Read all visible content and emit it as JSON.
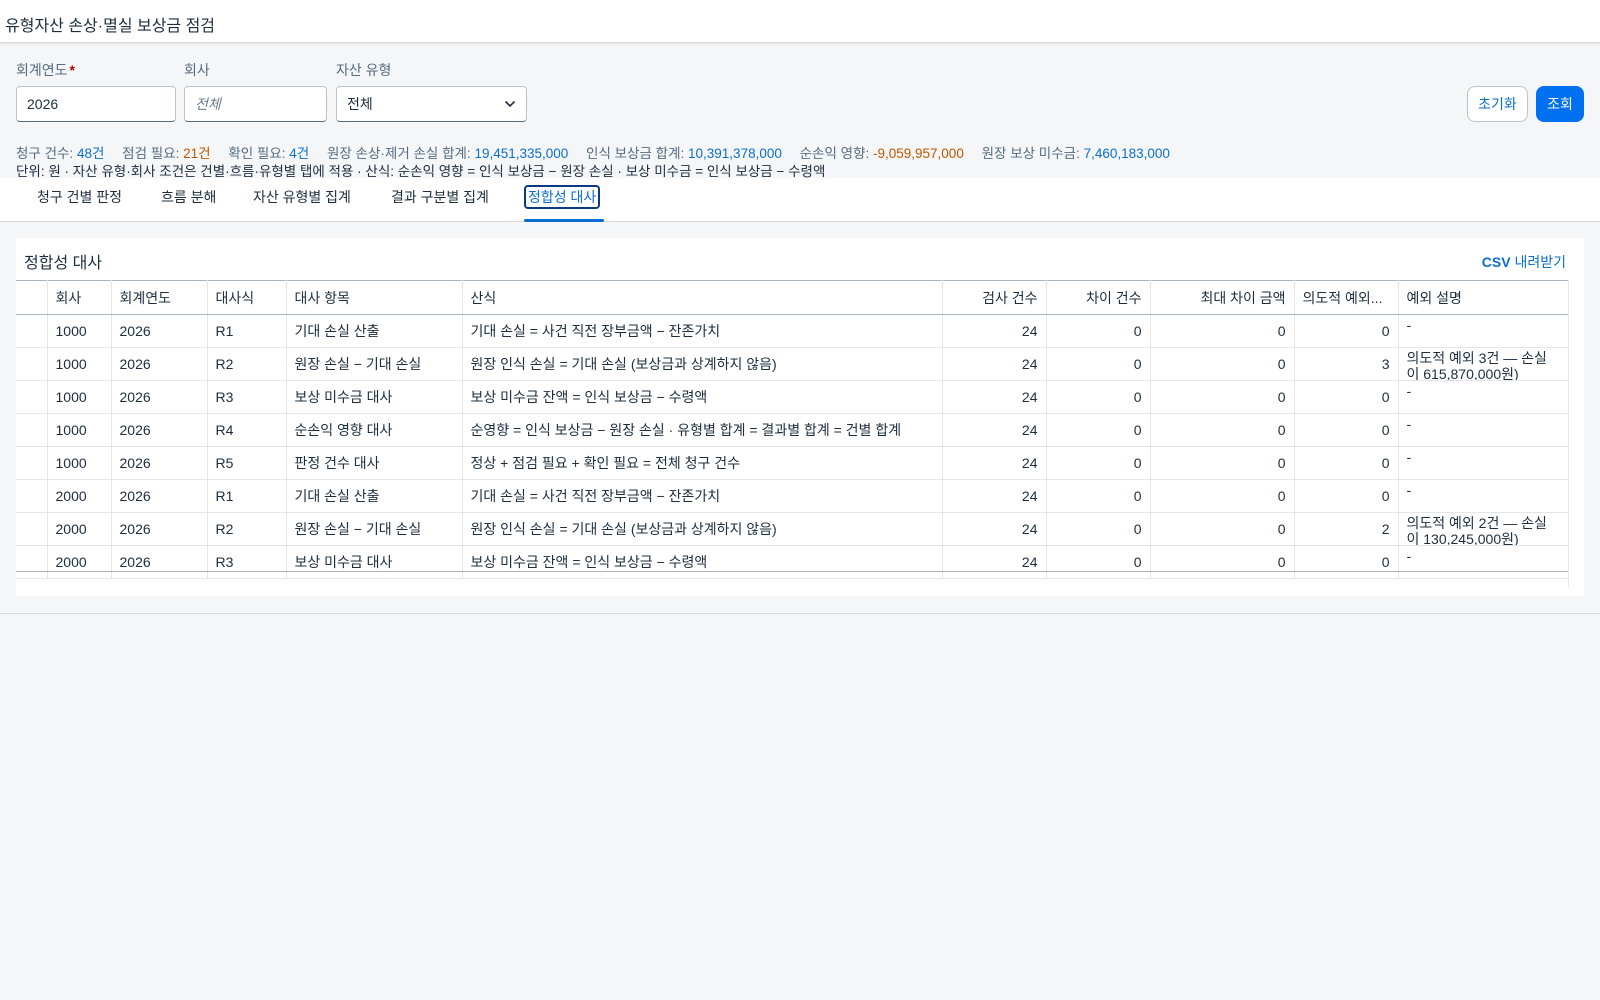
{
  "app": {
    "title": "유형자산 손상·멸실 보상금 점검"
  },
  "filters": {
    "fiscal_year_label": "회계연도",
    "fiscal_year_required": "*",
    "fiscal_year_value": "2026",
    "company_label": "회사",
    "company_placeholder": "전체",
    "asset_type_label": "자산 유형",
    "asset_type_value": "전체"
  },
  "actions": {
    "reset_label": "초기화",
    "search_label": "조회"
  },
  "summary": {
    "claims_label": "청구 건수:",
    "claims_value": "48건",
    "review_label": "점검 필요:",
    "review_value": "21건",
    "confirm_label": "확인 필요:",
    "confirm_value": "4건",
    "ledger_loss_label": "원장 손상·제거 손실 합계:",
    "ledger_loss_value": "19,451,335,000",
    "recognized_label": "인식 보상금 합계:",
    "recognized_value": "10,391,378,000",
    "net_impact_label": "순손익 영향:",
    "net_impact_value": "-9,059,957,000",
    "receivable_label": "원장 보상 미수금:",
    "receivable_value": "7,460,183,000",
    "note": "단위: 원 · 자산 유형·회사 조건은 건별·흐름·유형별 탭에 적용 · 산식: 순손익 영향 = 인식 보상금 − 원장 손실 · 보상 미수금 = 인식 보상금 − 수령액",
    "colors": {
      "value_blue": "#0a6ed1",
      "value_orange": "#c35500"
    }
  },
  "tabs": [
    {
      "label": "청구 건별 판정"
    },
    {
      "label": "흐름 분해"
    },
    {
      "label": "자산 유형별 집계"
    },
    {
      "label": "결과 구분별 집계"
    },
    {
      "label": "정합성 대사",
      "active": true
    }
  ],
  "panel": {
    "title": "정합성 대사",
    "csv_prefix": "CSV",
    "csv_label": "내려받기"
  },
  "table": {
    "columns": [
      "",
      "회사",
      "회계연도",
      "대사식",
      "대사 항목",
      "산식",
      "검사 건수",
      "차이 건수",
      "최대 차이 금액",
      "의도적 예외...",
      "예외 설명"
    ],
    "rows": [
      [
        "",
        "1000",
        "2026",
        "R1",
        "기대 손실 산출",
        "기대 손실 = 사건 직전 장부금액 − 잔존가치",
        "24",
        "0",
        "0",
        "0",
        "-"
      ],
      [
        "",
        "1000",
        "2026",
        "R2",
        "원장 손실 − 기대 손실",
        "원장 인식 손실 = 기대 손실 (보상금과 상계하지 않음)",
        "24",
        "0",
        "0",
        "3",
        "의도적 예외 3건 — 손실이 615,870,000원)"
      ],
      [
        "",
        "1000",
        "2026",
        "R3",
        "보상 미수금 대사",
        "보상 미수금 잔액 = 인식 보상금 − 수령액",
        "24",
        "0",
        "0",
        "0",
        "-"
      ],
      [
        "",
        "1000",
        "2026",
        "R4",
        "순손익 영향 대사",
        "순영향 = 인식 보상금 − 원장 손실 · 유형별 합계 = 결과별 합계 = 건별 합계",
        "24",
        "0",
        "0",
        "0",
        "-"
      ],
      [
        "",
        "1000",
        "2026",
        "R5",
        "판정 건수 대사",
        "정상 + 점검 필요 + 확인 필요 = 전체 청구 건수",
        "24",
        "0",
        "0",
        "0",
        "-"
      ],
      [
        "",
        "2000",
        "2026",
        "R1",
        "기대 손실 산출",
        "기대 손실 = 사건 직전 장부금액 − 잔존가치",
        "24",
        "0",
        "0",
        "0",
        "-"
      ],
      [
        "",
        "2000",
        "2026",
        "R2",
        "원장 손실 − 기대 손실",
        "원장 인식 손실 = 기대 손실 (보상금과 상계하지 않음)",
        "24",
        "0",
        "0",
        "2",
        "의도적 예외 2건 — 손실이 130,245,000원)"
      ],
      [
        "",
        "2000",
        "2026",
        "R3",
        "보상 미수금 대사",
        "보상 미수금 잔액 = 인식 보상금 − 수령액",
        "24",
        "0",
        "0",
        "0",
        "-"
      ]
    ]
  },
  "icons": {
    "select_chevron": "chevron-down-icon"
  }
}
